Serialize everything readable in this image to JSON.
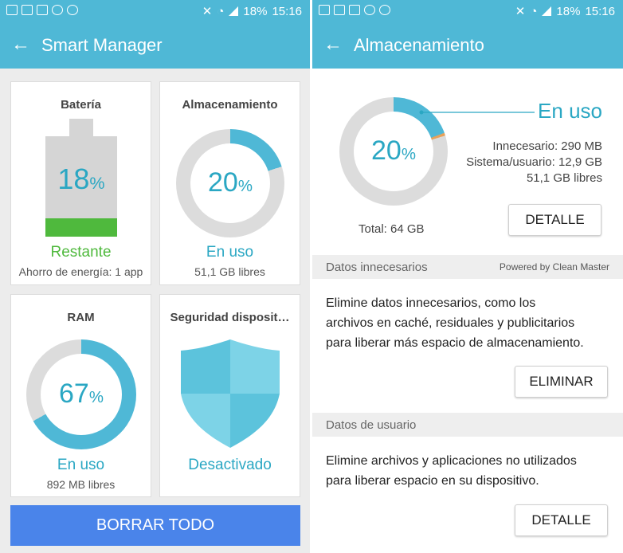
{
  "status_bar": {
    "battery": "18%",
    "time": "15:16",
    "left_icons": [
      "mail-icon",
      "word-icon",
      "image-icon",
      "sync-icon",
      "cloud-icon"
    ],
    "right_icons": [
      "mute-icon",
      "wifi-icon",
      "signal-icon"
    ]
  },
  "left": {
    "title": "Smart Manager",
    "battery_card": {
      "title": "Batería",
      "percent": "18",
      "percent_symbol": "%",
      "level": 0.18,
      "status": "Restante",
      "sub": "Ahorro de energía: 1 app"
    },
    "storage_card": {
      "title": "Almacenamiento",
      "percent": "20",
      "percent_symbol": "%",
      "level": 0.2,
      "status": "En uso",
      "sub": "51,1 GB libres"
    },
    "ram_card": {
      "title": "RAM",
      "percent": "67",
      "percent_symbol": "%",
      "level": 0.67,
      "status": "En uso",
      "sub": "892 MB libres"
    },
    "security_card": {
      "title": "Seguridad disposit…",
      "status": "Desactivado"
    },
    "clear_button": "BORRAR TODO"
  },
  "right": {
    "title": "Almacenamiento",
    "ring": {
      "percent": "20",
      "percent_symbol": "%",
      "level": 0.2
    },
    "in_use_label": "En uso",
    "details": [
      "Innecesario: 290 MB",
      "Sistema/usuario: 12,9 GB",
      "51,1 GB libres"
    ],
    "total": "Total: 64 GB",
    "detail_button": "DETALLE",
    "section_unnecessary": {
      "title": "Datos innecesarios",
      "powered_by": "Powered by Clean Master"
    },
    "unnecessary_text_lines": [
      "Elimine datos innecesarios, como los",
      "archivos en caché, residuales y publicitarios",
      "para liberar más espacio de almacenamiento."
    ],
    "delete_button": "ELIMINAR",
    "section_user": {
      "title": "Datos de usuario"
    },
    "user_text_lines": [
      "Elimine archivos y aplicaciones no utilizados",
      "para liberar espacio en su dispositivo."
    ],
    "user_detail_button": "DETALLE"
  },
  "colors": {
    "header": "#4fb8d6",
    "accent": "#2aa7c3",
    "ring_fill": "#4fb8d6",
    "ring_track": "#dcdcdc",
    "battery_green": "#4fb93d",
    "primary_button": "#4a84ea"
  }
}
